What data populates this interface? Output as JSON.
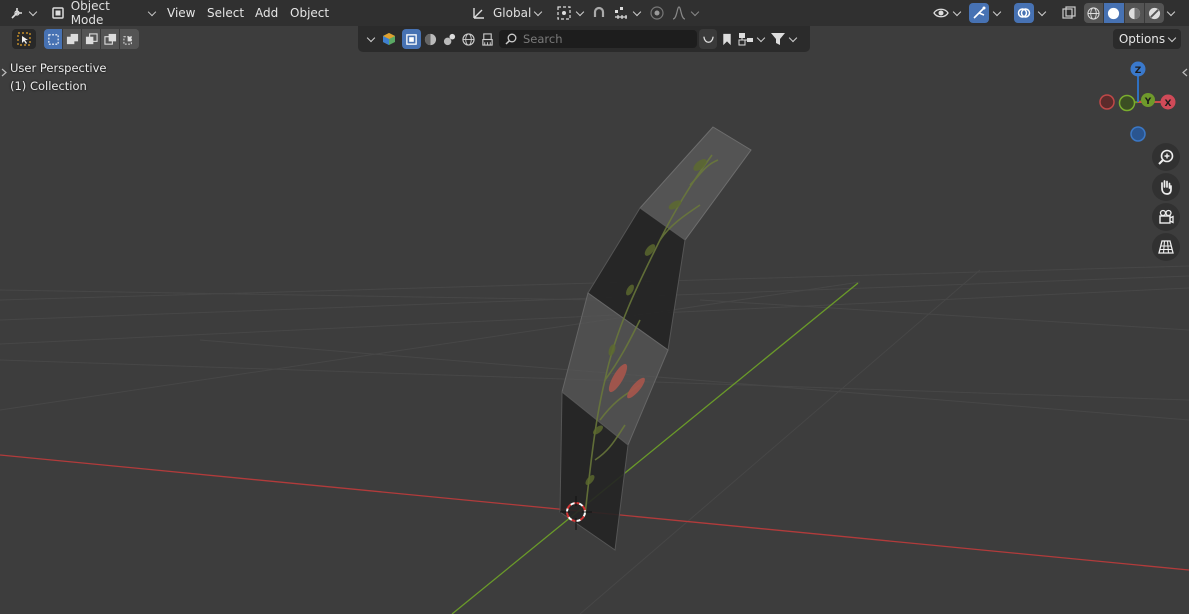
{
  "header": {
    "mode_label": "Object Mode",
    "menus": [
      "View",
      "Select",
      "Add",
      "Object"
    ],
    "transform_orientation": "Global"
  },
  "toolbar2": {
    "search_placeholder": "Search",
    "options_label": "Options"
  },
  "viewport": {
    "view_name": "User Perspective",
    "collection": "(1) Collection"
  },
  "gizmo": {
    "z_label": "Z",
    "y_label": "Y",
    "x_label": "X"
  },
  "colors": {
    "accent": "#4772b3",
    "header_bg": "#303030",
    "viewport_bg": "#3d3d3d",
    "x_axis": "#c94b4b",
    "y_axis": "#6a9a29",
    "z_axis": "#2f70c0"
  },
  "icons": {
    "editor_type": "editor-type-icon",
    "mode": "object-mode-icon",
    "orientation": "transform-orientation-icon",
    "pivot": "pivot-point-icon",
    "snap": "snap-magnet-icon",
    "increment": "snap-increment-icon",
    "proportional": "proportional-edit-icon",
    "falloff": "falloff-curve-icon",
    "visibility": "visibility-eye-icon",
    "gizmo": "gizmo-toggle-icon",
    "overlays": "overlays-icon",
    "xray": "xray-toggle-icon",
    "zoom": "zoom-icon",
    "pan": "pan-hand-icon",
    "camera": "camera-view-icon",
    "ortho": "perspective-grid-icon"
  }
}
